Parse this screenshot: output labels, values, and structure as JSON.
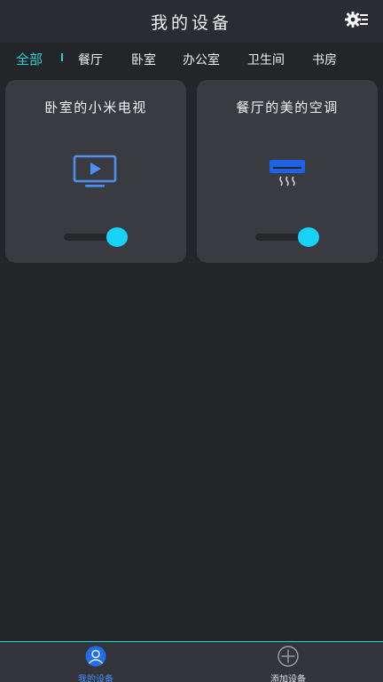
{
  "header": {
    "title": "我的设备",
    "settings_icon": "gear-list-icon"
  },
  "tabs": [
    {
      "label": "全部",
      "active": true
    },
    {
      "label": "餐厅",
      "active": false
    },
    {
      "label": "卧室",
      "active": false
    },
    {
      "label": "办公室",
      "active": false
    },
    {
      "label": "卫生间",
      "active": false
    },
    {
      "label": "书房",
      "active": false
    }
  ],
  "devices": [
    {
      "name": "卧室的小米电视",
      "icon": "tv-play-icon",
      "power_on": true
    },
    {
      "name": "餐厅的美的空调",
      "icon": "air-conditioner-icon",
      "power_on": true
    }
  ],
  "bottom_nav": {
    "mine_label": "我的设备",
    "add_label": "添加设备"
  },
  "colors": {
    "accent": "#22d3cf",
    "toggle_on": "#17d3f5",
    "icon_blue": "#3f8fff",
    "card_bg": "#3a3b41",
    "page_bg": "#242529"
  }
}
